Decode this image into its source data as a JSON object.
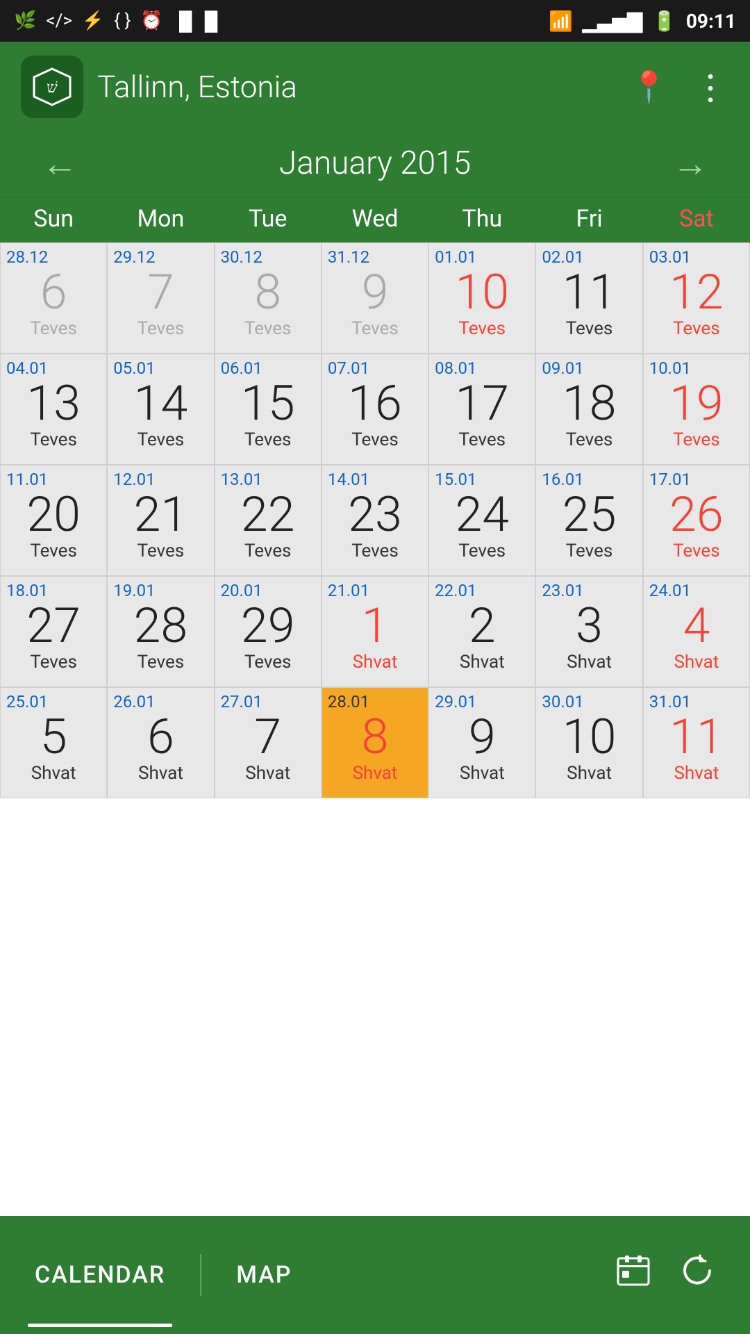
{
  "status_bar": {
    "time": "09:11",
    "icons_left": [
      "leaf-icon",
      "code-icon",
      "usb-icon",
      "brackets-icon",
      "clock-icon",
      "barcode-icon"
    ],
    "icons_right": [
      "wifi-icon",
      "signal-icon",
      "battery-icon"
    ]
  },
  "header": {
    "app_icon": "שּׁ",
    "location": "Tallinn, Estonia",
    "location_icon": "location-pin",
    "menu_icon": "more-vertical"
  },
  "nav": {
    "month_year": "January 2015",
    "prev_label": "←",
    "next_label": "→"
  },
  "day_headers": [
    "Sun",
    "Mon",
    "Tue",
    "Wed",
    "Thu",
    "Fri",
    "Sat"
  ],
  "weeks": [
    {
      "cells": [
        {
          "greg": "28.12",
          "main": "6",
          "heb": "Teves",
          "type": "prev",
          "sat": false,
          "sun": true
        },
        {
          "greg": "29.12",
          "main": "7",
          "heb": "Teves",
          "type": "prev",
          "sat": false,
          "sun": false
        },
        {
          "greg": "30.12",
          "main": "8",
          "heb": "Teves",
          "type": "prev",
          "sat": false,
          "sun": false
        },
        {
          "greg": "31.12",
          "main": "9",
          "heb": "Teves",
          "type": "prev",
          "sat": false,
          "sun": false
        },
        {
          "greg": "01.01",
          "main": "10",
          "heb": "Teves",
          "type": "normal",
          "sat": false,
          "sun": false,
          "highlight_num": "red",
          "highlight_heb": "red"
        },
        {
          "greg": "02.01",
          "main": "11",
          "heb": "Teves",
          "type": "normal",
          "sat": false,
          "sun": false
        },
        {
          "greg": "03.01",
          "main": "12",
          "heb": "Teves",
          "type": "normal",
          "sat": true,
          "sun": false,
          "highlight_num": "red",
          "highlight_heb": "red"
        }
      ]
    },
    {
      "cells": [
        {
          "greg": "04.01",
          "main": "13",
          "heb": "Teves",
          "type": "normal",
          "sat": false,
          "sun": true
        },
        {
          "greg": "05.01",
          "main": "14",
          "heb": "Teves",
          "type": "normal",
          "sat": false,
          "sun": false
        },
        {
          "greg": "06.01",
          "main": "15",
          "heb": "Teves",
          "type": "normal",
          "sat": false,
          "sun": false
        },
        {
          "greg": "07.01",
          "main": "16",
          "heb": "Teves",
          "type": "normal",
          "sat": false,
          "sun": false
        },
        {
          "greg": "08.01",
          "main": "17",
          "heb": "Teves",
          "type": "normal",
          "sat": false,
          "sun": false
        },
        {
          "greg": "09.01",
          "main": "18",
          "heb": "Teves",
          "type": "normal",
          "sat": false,
          "sun": false
        },
        {
          "greg": "10.01",
          "main": "19",
          "heb": "Teves",
          "type": "normal",
          "sat": true,
          "sun": false,
          "highlight_num": "red",
          "highlight_heb": "red"
        }
      ]
    },
    {
      "cells": [
        {
          "greg": "11.01",
          "main": "20",
          "heb": "Teves",
          "type": "normal",
          "sat": false,
          "sun": true
        },
        {
          "greg": "12.01",
          "main": "21",
          "heb": "Teves",
          "type": "normal",
          "sat": false,
          "sun": false
        },
        {
          "greg": "13.01",
          "main": "22",
          "heb": "Teves",
          "type": "normal",
          "sat": false,
          "sun": false
        },
        {
          "greg": "14.01",
          "main": "23",
          "heb": "Teves",
          "type": "normal",
          "sat": false,
          "sun": false
        },
        {
          "greg": "15.01",
          "main": "24",
          "heb": "Teves",
          "type": "normal",
          "sat": false,
          "sun": false
        },
        {
          "greg": "16.01",
          "main": "25",
          "heb": "Teves",
          "type": "normal",
          "sat": false,
          "sun": false
        },
        {
          "greg": "17.01",
          "main": "26",
          "heb": "Teves",
          "type": "normal",
          "sat": true,
          "sun": false,
          "highlight_num": "red",
          "highlight_heb": "red"
        }
      ]
    },
    {
      "cells": [
        {
          "greg": "18.01",
          "main": "27",
          "heb": "Teves",
          "type": "normal",
          "sat": false,
          "sun": true
        },
        {
          "greg": "19.01",
          "main": "28",
          "heb": "Teves",
          "type": "normal",
          "sat": false,
          "sun": false
        },
        {
          "greg": "20.01",
          "main": "29",
          "heb": "Teves",
          "type": "normal",
          "sat": false,
          "sun": false
        },
        {
          "greg": "21.01",
          "main": "1",
          "heb": "Shvat",
          "type": "normal",
          "sat": false,
          "sun": false,
          "highlight_num": "red",
          "highlight_heb": "red"
        },
        {
          "greg": "22.01",
          "main": "2",
          "heb": "Shvat",
          "type": "normal",
          "sat": false,
          "sun": false
        },
        {
          "greg": "23.01",
          "main": "3",
          "heb": "Shvat",
          "type": "normal",
          "sat": false,
          "sun": false
        },
        {
          "greg": "24.01",
          "main": "4",
          "heb": "Shvat",
          "type": "normal",
          "sat": true,
          "sun": false,
          "highlight_num": "red",
          "highlight_heb": "red"
        }
      ]
    },
    {
      "cells": [
        {
          "greg": "25.01",
          "main": "5",
          "heb": "Shvat",
          "type": "normal",
          "sat": false,
          "sun": true
        },
        {
          "greg": "26.01",
          "main": "6",
          "heb": "Shvat",
          "type": "normal",
          "sat": false,
          "sun": false
        },
        {
          "greg": "27.01",
          "main": "7",
          "heb": "Shvat",
          "type": "normal",
          "sat": false,
          "sun": false
        },
        {
          "greg": "28.01",
          "main": "8",
          "heb": "Shvat",
          "type": "today",
          "sat": false,
          "sun": false,
          "highlight_num": "red",
          "highlight_heb": "red"
        },
        {
          "greg": "29.01",
          "main": "9",
          "heb": "Shvat",
          "type": "normal",
          "sat": false,
          "sun": false
        },
        {
          "greg": "30.01",
          "main": "10",
          "heb": "Shvat",
          "type": "normal",
          "sat": false,
          "sun": false
        },
        {
          "greg": "31.01",
          "main": "11",
          "heb": "Shvat",
          "type": "normal",
          "sat": true,
          "sun": false,
          "highlight_num": "red",
          "highlight_heb": "red"
        }
      ]
    }
  ],
  "bottom_bar": {
    "tab_calendar": "CALENDAR",
    "tab_map": "MAP",
    "active_tab": "calendar",
    "icon_today": "calendar-today-icon",
    "icon_refresh": "refresh-icon"
  }
}
